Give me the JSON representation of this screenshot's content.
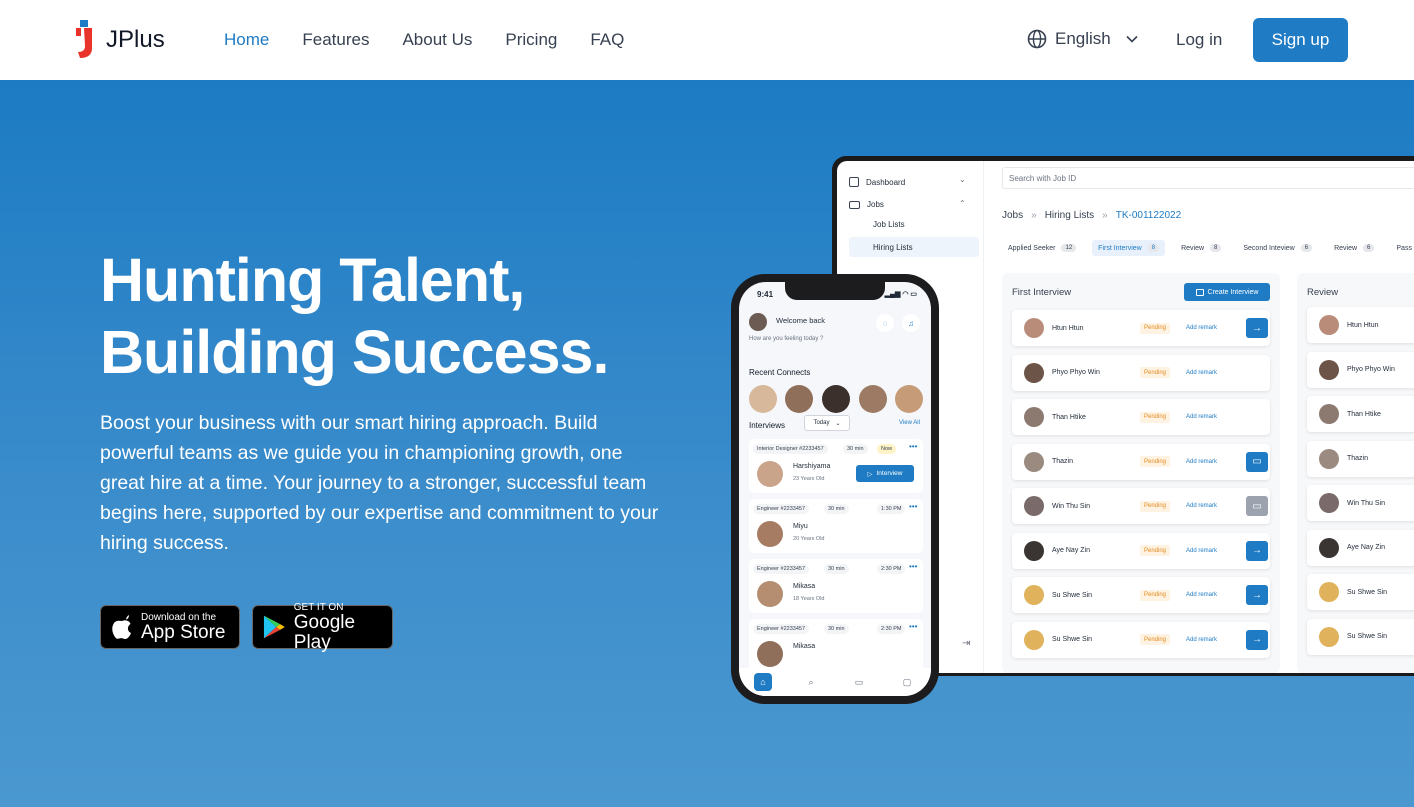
{
  "nav": {
    "logo_text": "JPlus",
    "links": [
      "Home",
      "Features",
      "About Us",
      "Pricing",
      "FAQ"
    ],
    "language": "English",
    "login": "Log in",
    "signup": "Sign up"
  },
  "hero": {
    "title_line1": "Hunting Talent,",
    "title_line2": "Building Success.",
    "description": "Boost your business with our smart hiring approach. Build powerful teams as we guide you in championing growth, one great hire at a time. Your journey to a stronger, successful team begins here, supported by our expertise and commitment to your hiring success.",
    "appstore_small": "Download on the",
    "appstore_big": "App Store",
    "googleplay_small": "GET IT ON",
    "googleplay_big": "Google Play"
  },
  "desktop": {
    "sidebar": [
      "Dashboard",
      "Jobs",
      "Job Lists",
      "Hiring Lists"
    ],
    "search_placeholder": "Search with Job ID",
    "breadcrumb": [
      "Jobs",
      "»",
      "Hiring Lists",
      "»",
      "TK-001122022"
    ],
    "tabs": [
      {
        "label": "Applied Seeker",
        "count": "12"
      },
      {
        "label": "First Interview",
        "count": "8"
      },
      {
        "label": "Review",
        "count": "8"
      },
      {
        "label": "Second Inteview",
        "count": "6"
      },
      {
        "label": "Review",
        "count": "6"
      },
      {
        "label": "Pass",
        "count": ""
      }
    ],
    "col1_title": "First Interview",
    "create_btn": "Create Interview",
    "col2_title": "Review",
    "pending": "Pending",
    "remark": "Add remark",
    "candidates": [
      "Htun Htun",
      "Phyo Phyo Win",
      "Than Htike",
      "Thazin",
      "Win Thu Sin",
      "Aye Nay Zin",
      "Su Shwe Sin",
      "Su Shwe Sin"
    ],
    "review_candidates": [
      "Htun Htun",
      "Phyo Phyo Win",
      "Than Htike",
      "Thazin",
      "Win Thu Sin",
      "Aye Nay Zin",
      "Su Shwe Sin",
      "Su Shwe Sin"
    ]
  },
  "phone": {
    "time": "9:41",
    "welcome": "Welcome back",
    "feeling": "How are you feeling today ?",
    "recent": "Recent Connects",
    "interviews": "Interviews",
    "today": "Today",
    "view_all": "View All",
    "cards": [
      {
        "role": "Interior Designer #2233457",
        "duration": "30 min",
        "time": "Now",
        "name": "Harshiyama",
        "age": "23 Years Old",
        "button": "Interview"
      },
      {
        "role": "Engineer #2233457",
        "duration": "30 min",
        "time": "1:30 PM",
        "name": "Miyu",
        "age": "20 Years Old"
      },
      {
        "role": "Engineer #2233457",
        "duration": "30 min",
        "time": "2:30 PM",
        "name": "Mikasa",
        "age": "18 Years Old"
      },
      {
        "role": "Engineer #2233457",
        "duration": "30 min",
        "time": "2:30 PM",
        "name": "Mikasa",
        "age": ""
      }
    ]
  },
  "colors": {
    "accent": "#1e7bc4",
    "pending": "#e58a1f",
    "logo_red": "#e8332a"
  }
}
